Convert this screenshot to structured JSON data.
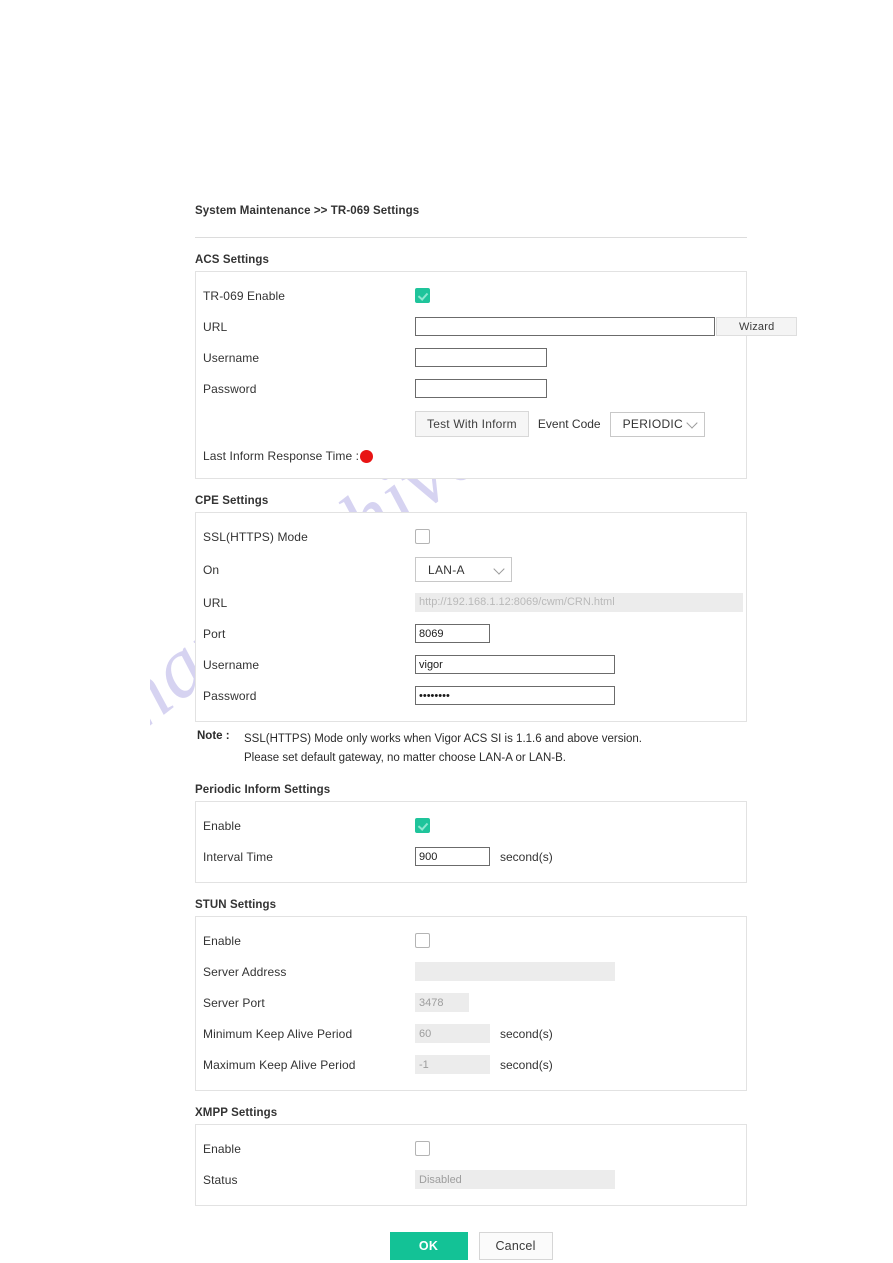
{
  "breadcrumb": "System Maintenance >> TR-069 Settings",
  "acs": {
    "title": "ACS Settings",
    "tr069_enable_label": "TR-069 Enable",
    "tr069_enable_checked": true,
    "url_label": "URL",
    "url_value": "",
    "wizard_label": "Wizard",
    "username_label": "Username",
    "username_value": "",
    "password_label": "Password",
    "password_value": "",
    "test_with_inform_label": "Test With Inform",
    "event_code_label": "Event Code",
    "event_code_value": "PERIODIC",
    "event_code_options": [
      "PERIODIC"
    ],
    "last_inform_label": "Last Inform Response Time :",
    "last_inform_status_color": "#e81414"
  },
  "cpe": {
    "title": "CPE Settings",
    "ssl_label": "SSL(HTTPS) Mode",
    "ssl_checked": false,
    "on_label": "On",
    "on_value": "LAN-A",
    "on_options": [
      "LAN-A",
      "LAN-B"
    ],
    "url_label": "URL",
    "url_value": "http://192.168.1.12:8069/cwm/CRN.html",
    "port_label": "Port",
    "port_value": "8069",
    "username_label": "Username",
    "username_value": "vigor",
    "password_label": "Password",
    "password_value": "••••••••",
    "note_key": "Note :",
    "note_line1": "SSL(HTTPS) Mode only works when Vigor ACS SI is 1.1.6 and above version.",
    "note_line2": "Please set default gateway, no matter choose LAN-A or LAN-B."
  },
  "periodic": {
    "title": "Periodic Inform Settings",
    "enable_label": "Enable",
    "enable_checked": true,
    "interval_label": "Interval Time",
    "interval_value": "900",
    "interval_unit": "second(s)"
  },
  "stun": {
    "title": "STUN Settings",
    "enable_label": "Enable",
    "enable_checked": false,
    "server_address_label": "Server Address",
    "server_address_value": "",
    "server_port_label": "Server Port",
    "server_port_value": "3478",
    "min_keep_alive_label": "Minimum Keep Alive Period",
    "min_keep_alive_value": "60",
    "min_keep_alive_unit": "second(s)",
    "max_keep_alive_label": "Maximum Keep Alive Period",
    "max_keep_alive_value": "-1",
    "max_keep_alive_unit": "second(s)"
  },
  "xmpp": {
    "title": "XMPP Settings",
    "enable_label": "Enable",
    "enable_checked": false,
    "status_label": "Status",
    "status_value": "Disabled"
  },
  "actions": {
    "ok_label": "OK",
    "cancel_label": "Cancel",
    "ok_color": "#13c296"
  },
  "watermark": {
    "text": "manualshive.com"
  }
}
